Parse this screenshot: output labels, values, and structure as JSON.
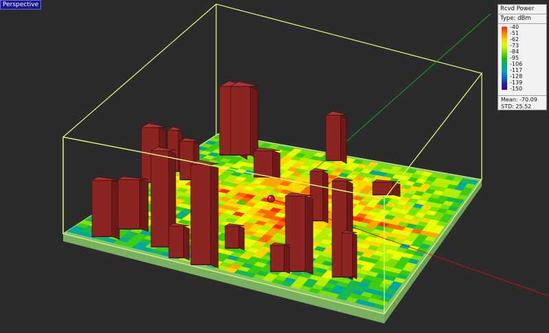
{
  "view": {
    "label": "Perspective"
  },
  "legend": {
    "title": "Rcvd Power",
    "type_label": "Type: dBm",
    "ticks": [
      "-40",
      "-51",
      "-62",
      "-73",
      "-84",
      "-95",
      "-106",
      "-117",
      "-128",
      "-139",
      "-150"
    ],
    "mean": "Mean: -70.09",
    "std": "STD: 25.52"
  },
  "colors": {
    "background": "#2b2b2b",
    "bounding_box": "#d9f77a",
    "building": "#8c2522",
    "x_axis": "#d01010",
    "y_axis": "#1aa31a",
    "base": "#86c36c"
  }
}
